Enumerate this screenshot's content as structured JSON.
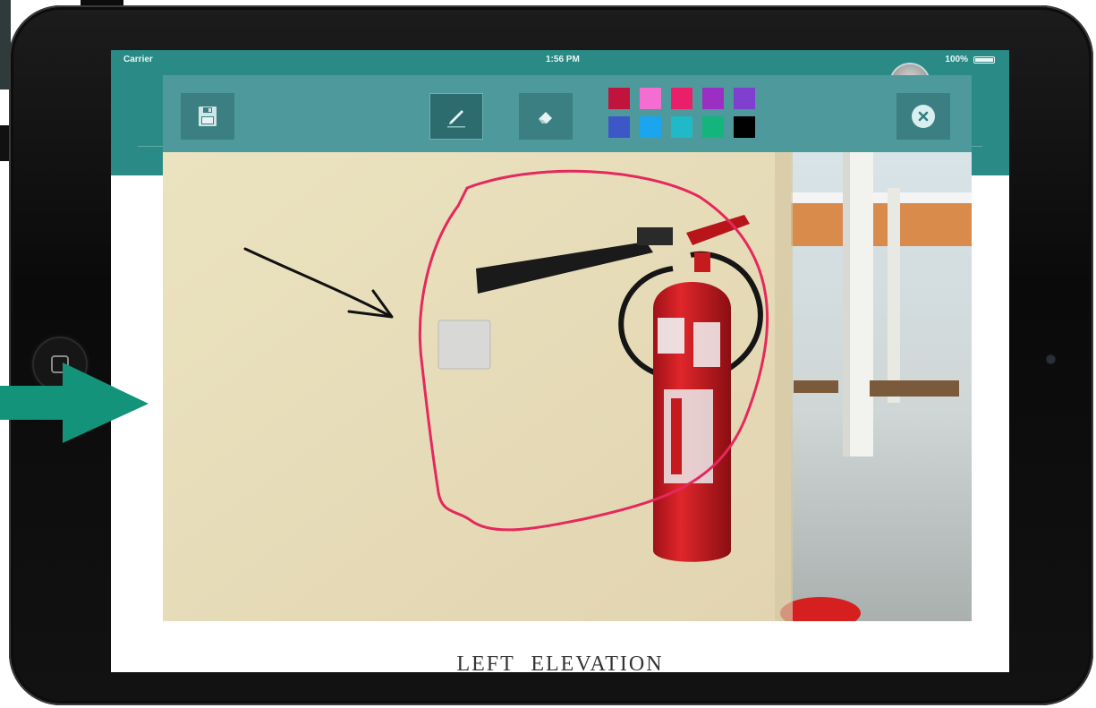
{
  "status_bar": {
    "carrier": "Carrier",
    "time": "1:56 PM",
    "battery": "100%"
  },
  "toolbar": {
    "save_icon": "floppy-disk-icon",
    "pen_icon": "pencil-icon",
    "eraser_icon": "eraser-icon",
    "close_icon": "close-x-icon",
    "palette": [
      "#c0143c",
      "#f36ed0",
      "#ea1f6a",
      "#9b2fc4",
      "#7f3fcf",
      "#3d57c8",
      "#1aa5ee",
      "#1fb9c8",
      "#13b57c",
      "#000000"
    ]
  },
  "photo": {
    "annotation_circle_color": "#e5285d",
    "annotation_arrow_color": "#111111"
  },
  "caption": "LEFT ELEVATION",
  "pointer_arrow_color": "#13937a"
}
